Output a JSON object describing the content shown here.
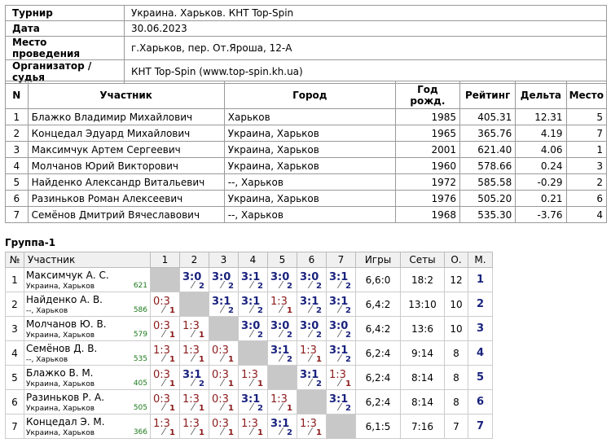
{
  "info": [
    {
      "label": "Турнир",
      "value": "Украина. Харьков. КНТ Top-Spin"
    },
    {
      "label": "Дата",
      "value": "30.06.2023"
    },
    {
      "label": "Место проведения",
      "value": "г.Харьков, пер. От.Яроша, 12-А"
    },
    {
      "label": "Организатор / судья",
      "value": "КНТ Top-Spin (www.top-spin.kh.ua)"
    }
  ],
  "participants": {
    "headers": [
      "N",
      "Участник",
      "Город",
      "Год рожд.",
      "Рейтинг",
      "Дельта",
      "Место"
    ],
    "rows": [
      [
        "1",
        "Блажко Владимир Михайлович",
        "Харьков",
        "1985",
        "405.31",
        "12.31",
        "5"
      ],
      [
        "2",
        "Концедал Эдуард Михайлович",
        "Украина, Харьков",
        "1965",
        "365.76",
        "4.19",
        "7"
      ],
      [
        "3",
        "Максимчук Артем Сергеевич",
        "Украина, Харьков",
        "2001",
        "621.40",
        "4.06",
        "1"
      ],
      [
        "4",
        "Молчанов Юрий Викторович",
        "Украина, Харьков",
        "1960",
        "578.66",
        "0.24",
        "3"
      ],
      [
        "5",
        "Найденко Александр Витальевич",
        "--, Харьков",
        "1972",
        "585.58",
        "-0.29",
        "2"
      ],
      [
        "6",
        "Разиньков Роман Алексеевич",
        "Украина, Харьков",
        "1976",
        "505.20",
        "0.21",
        "6"
      ],
      [
        "7",
        "Семёнов Дмитрий Вячеславович",
        "--, Харьков",
        "1968",
        "535.30",
        "-3.76",
        "4"
      ]
    ]
  },
  "group": {
    "title": "Группа-1",
    "headers": [
      "№",
      "Участник",
      "1",
      "2",
      "3",
      "4",
      "5",
      "6",
      "7",
      "Игры",
      "Сеты",
      "О.",
      "М."
    ],
    "rows": [
      {
        "n": "1",
        "name": "Максимчук А. С.",
        "city": "Украина, Харьков",
        "rating": "621",
        "scores": [
          "",
          "3:0",
          "3:0",
          "3:1",
          "3:0",
          "3:0",
          "3:1"
        ],
        "points": [
          "",
          "2",
          "2",
          "2",
          "2",
          "2",
          "2"
        ],
        "games": "6,6:0",
        "sets": "18:2",
        "o": "12",
        "m": "1"
      },
      {
        "n": "2",
        "name": "Найденко А. В.",
        "city": "--, Харьков",
        "rating": "586",
        "scores": [
          "0:3",
          "",
          "3:1",
          "3:1",
          "1:3",
          "3:1",
          "3:1"
        ],
        "points": [
          "1",
          "",
          "2",
          "2",
          "1",
          "2",
          "2"
        ],
        "games": "6,4:2",
        "sets": "13:10",
        "o": "10",
        "m": "2"
      },
      {
        "n": "3",
        "name": "Молчанов Ю. В.",
        "city": "Украина, Харьков",
        "rating": "579",
        "scores": [
          "0:3",
          "1:3",
          "",
          "3:0",
          "3:0",
          "3:0",
          "3:0"
        ],
        "points": [
          "1",
          "1",
          "",
          "2",
          "2",
          "2",
          "2"
        ],
        "games": "6,4:2",
        "sets": "13:6",
        "o": "10",
        "m": "3"
      },
      {
        "n": "4",
        "name": "Семёнов Д. В.",
        "city": "--, Харьков",
        "rating": "535",
        "scores": [
          "1:3",
          "1:3",
          "0:3",
          "",
          "3:1",
          "1:3",
          "3:1"
        ],
        "points": [
          "1",
          "1",
          "1",
          "",
          "2",
          "1",
          "2"
        ],
        "games": "6,2:4",
        "sets": "9:14",
        "o": "8",
        "m": "4"
      },
      {
        "n": "5",
        "name": "Блажко В. М.",
        "city": "Украина, Харьков",
        "rating": "405",
        "scores": [
          "0:3",
          "3:1",
          "0:3",
          "1:3",
          "",
          "3:1",
          "1:3"
        ],
        "points": [
          "1",
          "2",
          "1",
          "1",
          "",
          "2",
          "1"
        ],
        "games": "6,2:4",
        "sets": "8:14",
        "o": "8",
        "m": "5"
      },
      {
        "n": "6",
        "name": "Разиньков Р. А.",
        "city": "Украина, Харьков",
        "rating": "505",
        "scores": [
          "0:3",
          "1:3",
          "0:3",
          "3:1",
          "1:3",
          "",
          "3:1"
        ],
        "points": [
          "1",
          "1",
          "1",
          "2",
          "1",
          "",
          "2"
        ],
        "games": "6,2:4",
        "sets": "8:14",
        "o": "8",
        "m": "6"
      },
      {
        "n": "7",
        "name": "Концедал Э. М.",
        "city": "Украина, Харьков",
        "rating": "366",
        "scores": [
          "1:3",
          "1:3",
          "0:3",
          "1:3",
          "3:1",
          "1:3",
          ""
        ],
        "points": [
          "1",
          "1",
          "1",
          "1",
          "2",
          "1",
          ""
        ],
        "games": "6,1:5",
        "sets": "7:16",
        "o": "7",
        "m": "7"
      }
    ]
  }
}
